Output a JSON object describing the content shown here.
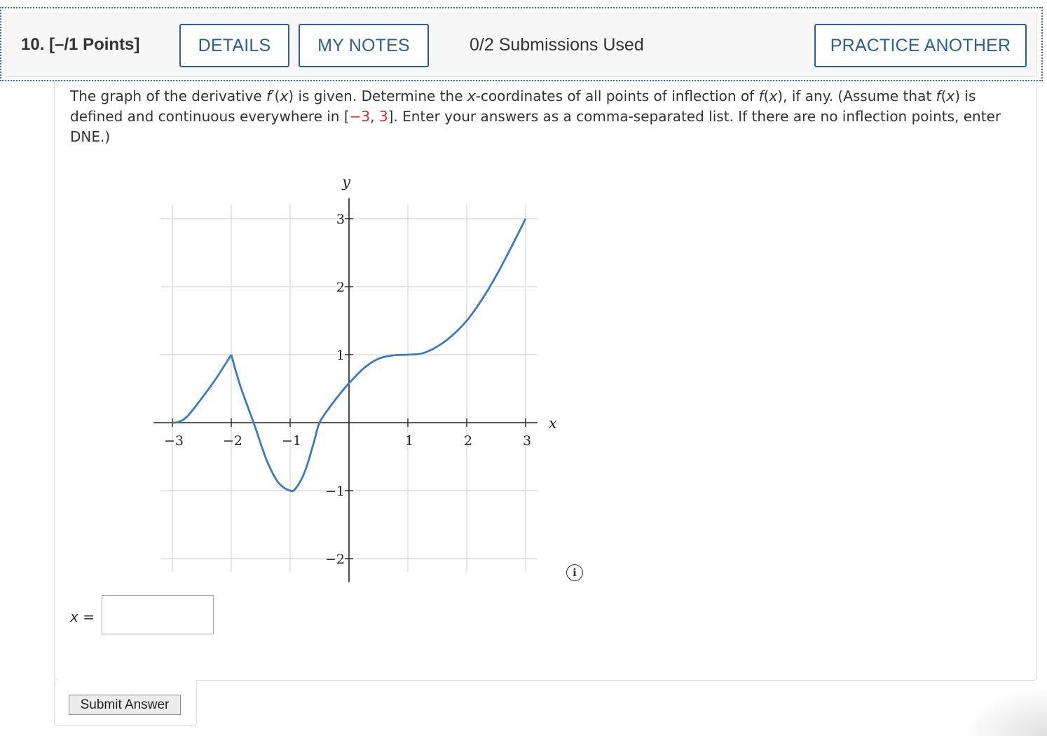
{
  "header": {
    "question_number": "10.",
    "points": "[–/1 Points]",
    "details_label": "DETAILS",
    "my_notes_label": "MY NOTES",
    "submissions_text": "0/2 Submissions Used",
    "practice_another_label": "PRACTICE ANOTHER"
  },
  "question": {
    "text_part1": "The graph of the derivative ",
    "fprime": "f′",
    "text_part2": "(",
    "x1": "x",
    "text_part3": ") is given. Determine the ",
    "x2": "x",
    "text_part4": "-coordinates of all points of inflection of ",
    "f1": "f",
    "text_part5": "(",
    "x3": "x",
    "text_part6": "), if any. (Assume that ",
    "f2": "f",
    "text_part7": "(",
    "x4": "x",
    "text_part8": ") is defined and continuous everywhere in [",
    "interval_low": "−3",
    "comma": ", ",
    "interval_high": "3",
    "text_part9": "]. Enter your answers as a comma-separated list. If there are no inflection points, enter DNE.)"
  },
  "chart_data": {
    "type": "line",
    "xlabel": "x",
    "ylabel": "y",
    "xlim": [
      -3.2,
      3.2
    ],
    "ylim": [
      -2.2,
      3.2
    ],
    "xticks": [
      -3,
      -2,
      -1,
      1,
      2,
      3
    ],
    "xtick_labels": [
      "−3",
      "−2",
      "−1",
      "1",
      "2",
      "3"
    ],
    "yticks": [
      -2,
      -1,
      1,
      2,
      3
    ],
    "ytick_labels": [
      "−2",
      "−1",
      "1",
      "2",
      "3"
    ],
    "grid": true,
    "line_color": "#3a7cc3",
    "series": [
      {
        "points": [
          [
            -3,
            0
          ],
          [
            -2.9,
            0.01
          ],
          [
            -2.75,
            0.09
          ],
          [
            -2.5,
            0.36
          ],
          [
            -2.25,
            0.66
          ],
          [
            -2,
            1
          ],
          [
            -1.85,
            0.55
          ],
          [
            -1.6,
            -0.05
          ],
          [
            -1.4,
            -0.55
          ],
          [
            -1.2,
            -0.88
          ],
          [
            -1,
            -1
          ],
          [
            -0.9,
            -0.96
          ],
          [
            -0.75,
            -0.72
          ],
          [
            -0.6,
            -0.3
          ],
          [
            -0.5,
            0
          ],
          [
            -0.3,
            0.26
          ],
          [
            -0.1,
            0.48
          ],
          [
            0,
            0.58
          ],
          [
            0.25,
            0.8
          ],
          [
            0.5,
            0.94
          ],
          [
            0.75,
            0.99
          ],
          [
            1,
            1
          ],
          [
            1.25,
            1.02
          ],
          [
            1.5,
            1.12
          ],
          [
            1.75,
            1.28
          ],
          [
            2,
            1.5
          ],
          [
            2.25,
            1.8
          ],
          [
            2.5,
            2.16
          ],
          [
            2.75,
            2.57
          ],
          [
            3,
            3
          ]
        ]
      }
    ]
  },
  "answer": {
    "label_var": "x",
    "label_eq": " =",
    "value": "",
    "placeholder": ""
  },
  "submit_label": "Submit Answer",
  "icons": {
    "info": "info-icon"
  }
}
